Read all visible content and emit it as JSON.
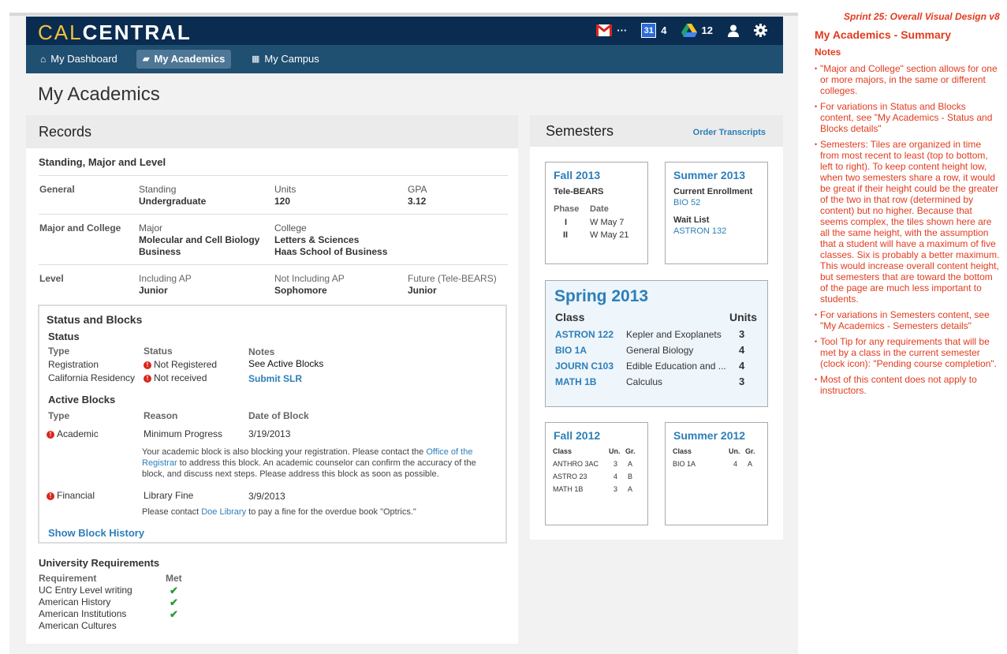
{
  "header": {
    "logo_cal": "CAL",
    "logo_central": "CENTRAL",
    "mail_badge": "···",
    "calendar_day": "31",
    "calendar_badge": "4",
    "drive_badge": "12"
  },
  "nav": {
    "items": [
      {
        "label": "My Dashboard",
        "icon": "home-icon",
        "active": false
      },
      {
        "label": "My Academics",
        "icon": "book-icon",
        "active": true
      },
      {
        "label": "My Campus",
        "icon": "grid-icon",
        "active": false
      }
    ]
  },
  "page_title": "My Academics",
  "records": {
    "title": "Records",
    "standing_title": "Standing, Major and Level",
    "general_label": "General",
    "standing_label": "Standing",
    "standing_value": "Undergraduate",
    "units_label": "Units",
    "units_value": "120",
    "gpa_label": "GPA",
    "gpa_value": "3.12",
    "major_college_label": "Major and College",
    "major_label": "Major",
    "major_1": "Molecular and Cell Biology",
    "major_2": "Business",
    "college_label": "College",
    "college_1": "Letters & Sciences",
    "college_2": "Haas School of Business",
    "level_label": "Level",
    "incl_ap_label": "Including AP",
    "incl_ap_value": "Junior",
    "not_incl_ap_label": "Not Including AP",
    "not_incl_ap_value": "Sophomore",
    "future_label": "Future (Tele-BEARS)",
    "future_value": "Junior"
  },
  "status_blocks": {
    "title": "Status and Blocks",
    "status_title": "Status",
    "col_type": "Type",
    "col_status": "Status",
    "col_notes": "Notes",
    "registration_label": "Registration",
    "registration_status": "Not Registered",
    "registration_note": "See Active Blocks",
    "residency_label": "California Residency",
    "residency_status": "Not received",
    "residency_note": "Submit SLR",
    "active_title": "Active Blocks",
    "col_reason": "Reason",
    "col_date": "Date of Block",
    "academic_label": "Academic",
    "academic_reason": "Minimum Progress",
    "academic_date": "3/19/2013",
    "academic_msg_1": "Your academic block is also blocking your registration. Please contact the ",
    "academic_link_1": "Office of the",
    "academic_link_2": "Registrar",
    "academic_msg_2": " to address this block. An academic counselor can confirm the accuracy of the",
    "academic_msg_3": "block, and discuss next steps. Please address this block as soon as possible.",
    "financial_label": "Financial",
    "financial_reason": "Library Fine",
    "financial_date": "3/9/2013",
    "financial_msg_1": "Please contact ",
    "financial_link": "Doe Library",
    "financial_msg_2": " to pay a fine for the overdue book \"Optrics.\"",
    "history_link": "Show Block History"
  },
  "university_requirements": {
    "title": "University Requirements",
    "col_requirement": "Requirement",
    "col_met": "Met",
    "items": [
      {
        "name": "UC Entry Level writing",
        "met": true
      },
      {
        "name": "American History",
        "met": true
      },
      {
        "name": "American Institutions",
        "met": true
      },
      {
        "name": "American Cultures",
        "met": false
      }
    ]
  },
  "semesters": {
    "title": "Semesters",
    "order_link": "Order Transcripts",
    "fall2013": {
      "title": "Fall 2013",
      "subtitle": "Tele-BEARS",
      "col_phase": "Phase",
      "col_date": "Date",
      "rows": [
        {
          "phase": "I",
          "date": "W May  7"
        },
        {
          "phase": "II",
          "date": "W May 21"
        }
      ]
    },
    "summer2013": {
      "title": "Summer 2013",
      "enrollment_label": "Current Enrollment",
      "enrollment_class": "BIO 52",
      "waitlist_label": "Wait List",
      "waitlist_class": "ASTRON 132"
    },
    "spring2013": {
      "title": "Spring 2013",
      "col_class": "Class",
      "col_units": "Units",
      "rows": [
        {
          "code": "ASTRON 122",
          "name": "Kepler and Exoplanets",
          "units": "3"
        },
        {
          "code": "BIO 1A",
          "name": "General Biology",
          "units": "4"
        },
        {
          "code": "JOURN C103",
          "name": "Edible Education and ...",
          "units": "4"
        },
        {
          "code": "MATH 1B",
          "name": "Calculus",
          "units": "3"
        }
      ]
    },
    "fall2012": {
      "title": "Fall 2012",
      "col_class": "Class",
      "col_un": "Un.",
      "col_gr": "Gr.",
      "rows": [
        {
          "code": "ANTHRO 3AC",
          "un": "3",
          "gr": "A"
        },
        {
          "code": "ASTRO 23",
          "un": "4",
          "gr": "B"
        },
        {
          "code": "MATH 1B",
          "un": "3",
          "gr": "A"
        }
      ]
    },
    "summer2012": {
      "title": "Summer 2012",
      "col_class": "Class",
      "col_un": "Un.",
      "col_gr": "Gr.",
      "rows": [
        {
          "code": "BIO 1A",
          "un": "4",
          "gr": "A"
        }
      ]
    }
  },
  "notes": {
    "sprint": "Sprint 25: Overall Visual Design v8",
    "heading": "My Academics - Summary",
    "notes_label": "Notes",
    "items": [
      "\"Major and College\" section allows for one or more majors, in the same or different colleges.",
      "For variations in Status and Blocks content, see \"My Academics - Status and Blocks details\"",
      "Semesters: Tiles are organized in time from most recent to least (top to bottom, left to right). To keep content height low, when two semesters share a row, it would be great if their height could be the greater of the two in that row (determined by content) but no higher. Because that seems complex, the tiles shown here are all the same height, with the assumption that a student will have a maximum of five classes. Six is probably a better maximum. This would increase overall content height, but semesters that are toward the bottom of the page are much less important to students.",
      "For variations in Semesters content, see \"My Academics - Semesters details\"",
      "Tool Tip for any requirements that will be met by a class in the current semester (clock icon): \"Pending course completion\".",
      "Most of this content does not apply to instructors."
    ]
  },
  "colors": {
    "topbar": "#0a2c51",
    "navbar": "#1f4f71",
    "link": "#2c7fb8",
    "alert": "#d9261c",
    "check": "#2a9a3a",
    "notes": "#e23b1e",
    "logo_gold": "#f3c33b"
  }
}
